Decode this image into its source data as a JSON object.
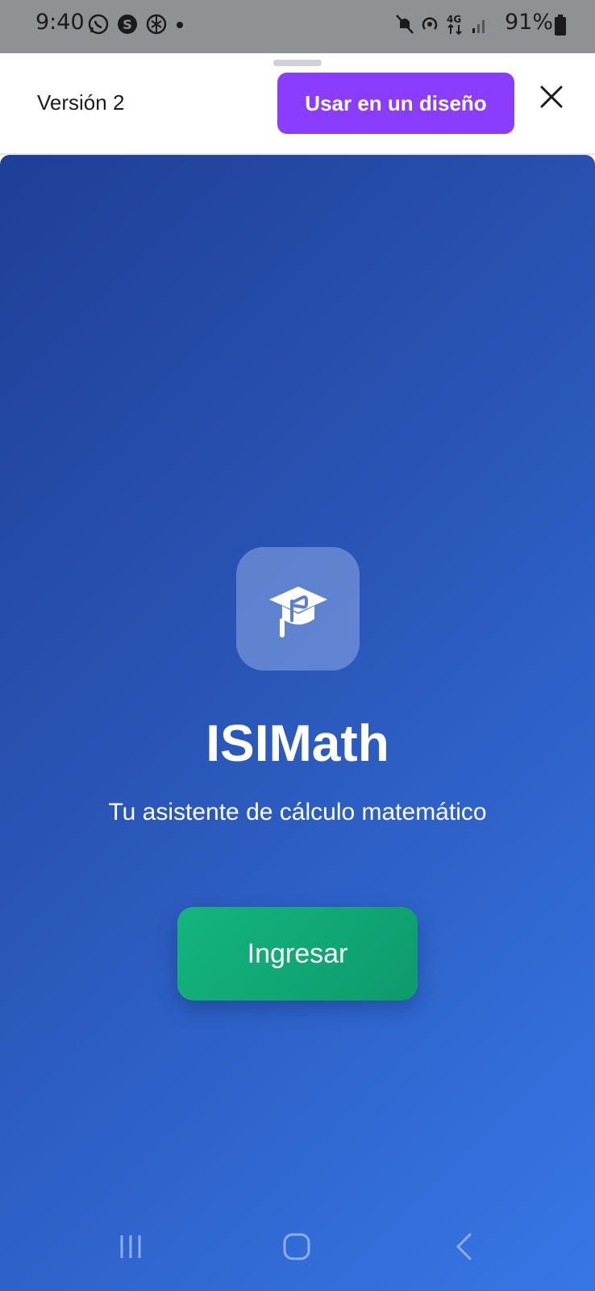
{
  "status_bar": {
    "time": "9:40",
    "battery": "91%",
    "network": "4G"
  },
  "header": {
    "version_label": "Versión 2",
    "use_button_label": "Usar en un diseño",
    "accent_color": "#8b3dff"
  },
  "preview": {
    "app_title": "ISIMath",
    "subtitle": "Tu asistente de cálculo matemático",
    "enter_button_label": "Ingresar",
    "icon": "graduation-cap-icon",
    "gradient_start": "#1f3f96",
    "gradient_end": "#3677e6",
    "button_color": "#14b57f"
  },
  "nav": {
    "items": [
      "recent-apps-icon",
      "home-icon",
      "back-icon"
    ]
  }
}
